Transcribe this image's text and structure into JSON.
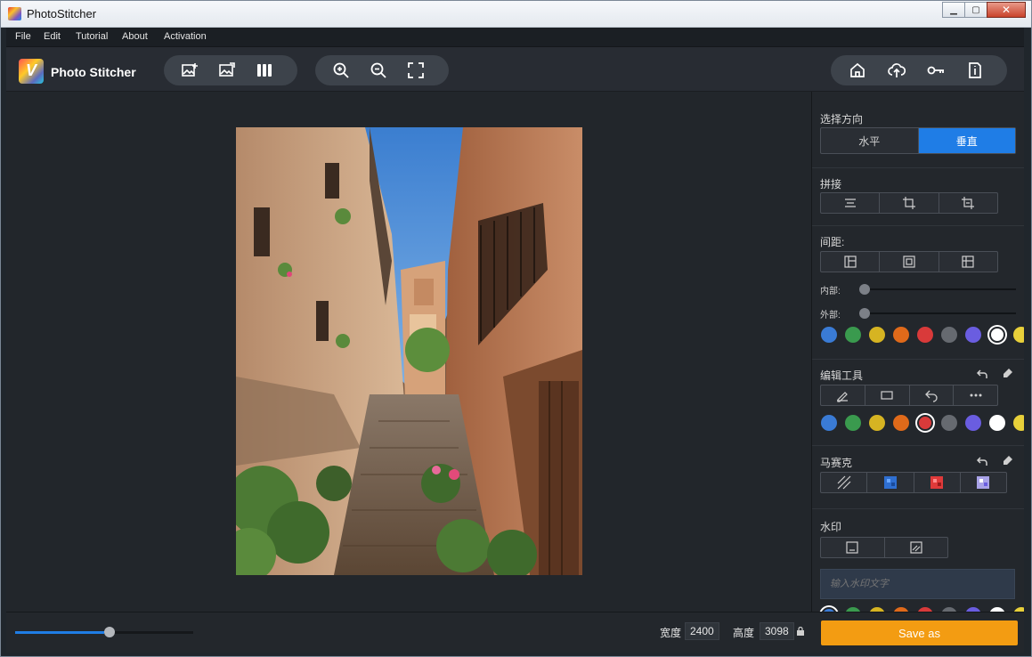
{
  "window": {
    "title": "PhotoStitcher",
    "min": "▁",
    "max": "▢",
    "close": "✕"
  },
  "menu": [
    "File",
    "Edit",
    "Tutorial",
    "About",
    "Activation"
  ],
  "toolbar": {
    "brand": "Photo Stitcher"
  },
  "sidebar": {
    "direction": {
      "label": "选择方向",
      "options": [
        "水平",
        "垂直"
      ],
      "selected": "垂直"
    },
    "stitch": {
      "label": "拼接"
    },
    "spacing": {
      "label": "间距:",
      "inner_label": "内部:",
      "outer_label": "外部:",
      "inner_value": 0,
      "outer_value": 0
    },
    "edit_tools": {
      "label": "编辑工具"
    },
    "mosaic": {
      "label": "马赛克"
    },
    "watermark": {
      "label": "水印",
      "placeholder": "输入水印文字"
    },
    "colors": [
      "#3a7bd5",
      "#3a9a4e",
      "#d6b422",
      "#e06a1a",
      "#d93a3a",
      "#666a70",
      "#6a5de0",
      "#ffffff",
      "#e8d03a"
    ],
    "spacing_selected_color": "#ffffff",
    "edit_selected_color": "#d93a3a",
    "watermark_selected_color": "#3a7bd5"
  },
  "bottom": {
    "zoom_percent": 50,
    "width_label": "宽度",
    "width_value": "2400",
    "height_label": "高度",
    "height_value": "3098",
    "save_label": "Save as"
  }
}
